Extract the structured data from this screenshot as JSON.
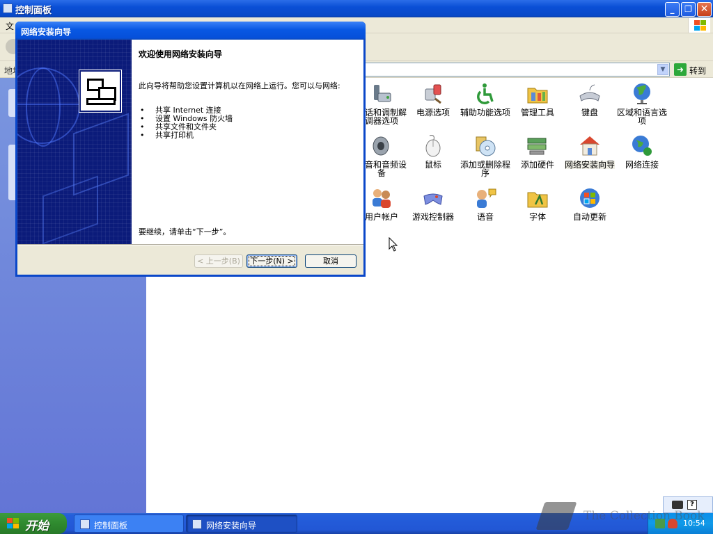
{
  "cp_window": {
    "title": "控制面板",
    "menu_first": "文",
    "address_label": "地址",
    "go_label": "转到"
  },
  "cp_items": [
    {
      "label": "电话和调制解调器选项",
      "icon": "phone-modem-icon"
    },
    {
      "label": "电源选项",
      "icon": "power-options-icon"
    },
    {
      "label": "辅助功能选项",
      "icon": "accessibility-icon"
    },
    {
      "label": "管理工具",
      "icon": "admin-tools-icon"
    },
    {
      "label": "键盘",
      "icon": "keyboard-icon"
    },
    {
      "label": "区域和语言选项",
      "icon": "globe-icon"
    },
    {
      "label": "声音和音频设备",
      "icon": "speaker-icon"
    },
    {
      "label": "鼠标",
      "icon": "mouse-icon"
    },
    {
      "label": "添加或删除程序",
      "icon": "add-remove-programs-icon"
    },
    {
      "label": "添加硬件",
      "icon": "add-hardware-icon"
    },
    {
      "label": "网络安装向导",
      "icon": "network-setup-house-icon"
    },
    {
      "label": "网络连接",
      "icon": "network-connections-icon"
    },
    {
      "label": "用户帐户",
      "icon": "user-accounts-icon"
    },
    {
      "label": "游戏控制器",
      "icon": "game-controller-icon"
    },
    {
      "label": "语音",
      "icon": "speech-icon"
    },
    {
      "label": "字体",
      "icon": "fonts-folder-icon"
    },
    {
      "label": "自动更新",
      "icon": "windows-update-icon"
    }
  ],
  "wizard": {
    "title": "网络安装向导",
    "heading": "欢迎使用网络安装向导",
    "intro": "此向导将帮助您设置计算机以在网络上运行。您可以与网络:",
    "bullets": [
      "共享 Internet 连接",
      "设置 Windows 防火墙",
      "共享文件和文件夹",
      "共享打印机"
    ],
    "continue_text": "要继续，请单击“下一步”。",
    "back_label": "< 上一步(B)",
    "next_label": "下一步(N) >",
    "cancel_label": "取消"
  },
  "taskbar": {
    "start_label": "开始",
    "tasks": [
      "控制面板",
      "网络安装向导"
    ],
    "clock": "10:54"
  },
  "lang_bar": {
    "help": "?"
  },
  "watermark": {
    "text": "The Collection Book"
  },
  "colors": {
    "titlebar_blue": "#0a4fd6",
    "taskbar_blue": "#245edb",
    "start_green": "#2f8a2f",
    "wizard_side": "#0b1b7a",
    "tray_blue": "#109ae9"
  }
}
